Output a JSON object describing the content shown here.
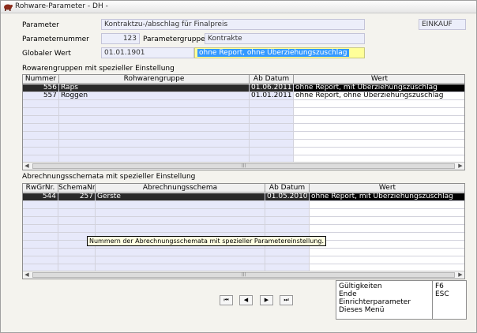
{
  "window": {
    "title": "Rohware-Parameter - DH -"
  },
  "form": {
    "parameter_label": "Parameter",
    "parameter_value": "Kontraktzu-/abschlag für Finalpreis",
    "einkauf": "EINKAUF",
    "parameternummer_label": "Parameternummer",
    "parameternummer_value": "123",
    "parametergruppe_label": "Parametergruppe",
    "parametergruppe_value": "Kontrakte",
    "globaler_wert_label": "Globaler Wert",
    "globaler_wert_date": "01.01.1901",
    "globaler_wert_value": "ohne Report, ohne Überziehungszuschlag"
  },
  "rowarengruppen": {
    "title": "Rowarengruppen mit spezieller Einstellung",
    "headers": [
      "Nummer",
      "Rohwarengruppe",
      "Ab Datum",
      "Wert"
    ],
    "rows": [
      {
        "nummer": "556",
        "gruppe": "Raps",
        "datum": "01.06.2011",
        "wert": "ohne Report, mit Überziehungszuschlag"
      },
      {
        "nummer": "557",
        "gruppe": "Roggen",
        "datum": "01.01.2011",
        "wert": "ohne Report, ohne Überziehungszuschlag"
      }
    ]
  },
  "abrechnung": {
    "title": "Abrechnungsschemata mit spezieller Einstellung",
    "headers": [
      "RwGrNr.",
      "SchemaNr",
      "Abrechnungsschema",
      "Ab Datum",
      "Wert"
    ],
    "rows": [
      {
        "rwgrnr": "544",
        "schemanr": "257",
        "schema": "Gerste",
        "datum": "01.05.2010",
        "wert": "ohne Report, mit Überziehungszuschlag"
      }
    ],
    "tooltip": "Nummern der Abrechnungsschemata mit spezieller Parametereinstellung."
  },
  "nav": {
    "first": "⏮",
    "prev": "◀",
    "next": "▶",
    "last": "⏭"
  },
  "menu": {
    "items": [
      {
        "label": "Gültigkeiten",
        "key": "F6"
      },
      {
        "label": "Ende",
        "key": "ESC"
      },
      {
        "label": "Einrichterparameter",
        "key": ""
      },
      {
        "label": "Dieses Menü",
        "key": ""
      }
    ]
  }
}
